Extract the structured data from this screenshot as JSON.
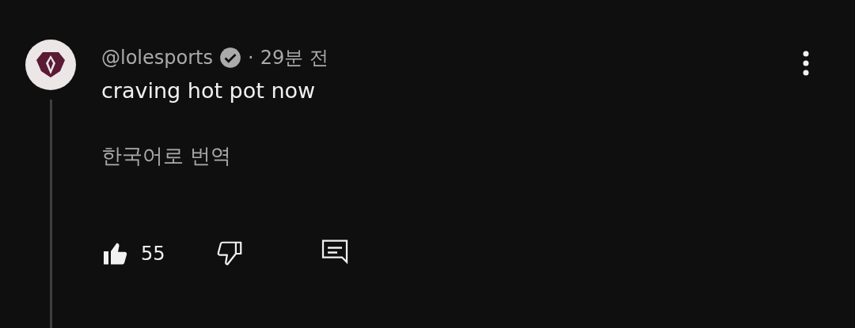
{
  "comment": {
    "handle": "@lolesports",
    "verified": true,
    "separator": "·",
    "time": "29분 전",
    "text": "craving hot pot now",
    "translate": "한국어로 번역",
    "actions": {
      "liked": true,
      "like_count": "55",
      "disliked": false
    }
  }
}
